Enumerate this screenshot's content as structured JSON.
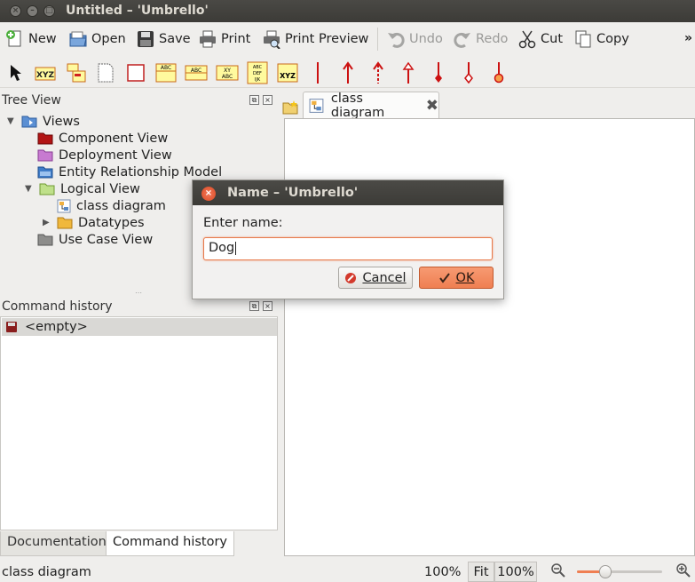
{
  "window": {
    "title": "Untitled – 'Umbrello'"
  },
  "toolbar": {
    "new": "New",
    "open": "Open",
    "save": "Save",
    "print": "Print",
    "print_preview": "Print Preview",
    "undo": "Undo",
    "redo": "Redo",
    "cut": "Cut",
    "copy": "Copy",
    "overflow": "»"
  },
  "tree_view": {
    "title": "Tree View",
    "items": [
      {
        "label": "Views"
      },
      {
        "label": "Component View"
      },
      {
        "label": "Deployment View"
      },
      {
        "label": "Entity Relationship Model"
      },
      {
        "label": "Logical View"
      },
      {
        "label": "class diagram"
      },
      {
        "label": "Datatypes"
      },
      {
        "label": "Use Case View"
      }
    ]
  },
  "command_history": {
    "title": "Command history",
    "items": [
      {
        "label": "<empty>"
      }
    ]
  },
  "bottom_tabs": {
    "documentation": "Documentation",
    "command_history": "Command history"
  },
  "document_tab": {
    "label": "class diagram"
  },
  "statusbar": {
    "text": "class diagram",
    "zoom": "100%",
    "fit": "Fit",
    "zoom_btn": "100%",
    "zoom_level": 0.33
  },
  "dialog": {
    "title": "Name – 'Umbrello'",
    "prompt": "Enter name:",
    "value": "Dog",
    "cancel": "Cancel",
    "ok": "OK"
  },
  "colors": {
    "accent": "#ef7f52",
    "title_bar": "#3c3b37",
    "relation_red": "#cc1111"
  }
}
